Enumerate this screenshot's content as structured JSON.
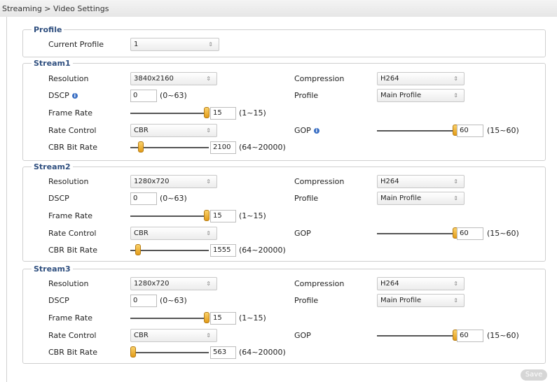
{
  "breadcrumb": "Streaming > Video Settings",
  "profile_section": {
    "legend": "Profile",
    "current_profile_label": "Current Profile",
    "current_profile_value": "1"
  },
  "labels": {
    "resolution": "Resolution",
    "dscp": "DSCP",
    "frame_rate": "Frame Rate",
    "rate_control": "Rate Control",
    "cbr_bit_rate": "CBR Bit Rate",
    "compression": "Compression",
    "profile": "Profile",
    "gop": "GOP"
  },
  "hints": {
    "dscp_range": "(0~63)",
    "frame_rate_range": "(1~15)",
    "cbr_range": "(64~20000)",
    "gop_range": "(15~60)"
  },
  "streams": [
    {
      "legend": "Stream1",
      "resolution": "3840x2160",
      "dscp": "0",
      "frame_rate": "15",
      "frame_rate_fraction": 1.0,
      "rate_control": "CBR",
      "cbr_bit_rate": "2100",
      "cbr_fraction": 0.1,
      "compression": "H264",
      "profile": "Main Profile",
      "gop": "60",
      "gop_fraction": 1.0
    },
    {
      "legend": "Stream2",
      "resolution": "1280x720",
      "dscp": "0",
      "frame_rate": "15",
      "frame_rate_fraction": 1.0,
      "rate_control": "CBR",
      "cbr_bit_rate": "1555",
      "cbr_fraction": 0.07,
      "compression": "H264",
      "profile": "Main Profile",
      "gop": "60",
      "gop_fraction": 1.0
    },
    {
      "legend": "Stream3",
      "resolution": "1280x720",
      "dscp": "0",
      "frame_rate": "15",
      "frame_rate_fraction": 1.0,
      "rate_control": "CBR",
      "cbr_bit_rate": "563",
      "cbr_fraction": 0.0,
      "compression": "H264",
      "profile": "Main Profile",
      "gop": "60",
      "gop_fraction": 1.0
    }
  ],
  "save_label": "Save",
  "select_arrow": "⇕",
  "info_icon": "i"
}
